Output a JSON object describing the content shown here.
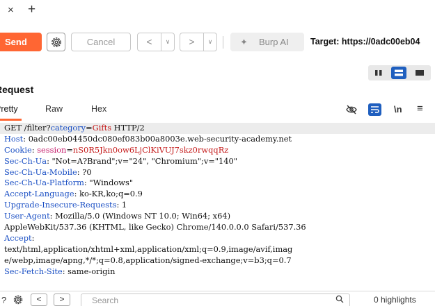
{
  "tabs": {
    "close_glyph": "×",
    "add_glyph": "+"
  },
  "toolbar": {
    "send_label": "Send",
    "cancel_label": "Cancel",
    "back_glyph": "<",
    "back_menu_glyph": "∨",
    "forward_glyph": ">",
    "forward_menu_glyph": "∨",
    "burp_ai_label": "Burp AI",
    "target_text": "Target: https://0adc00eb04",
    "accent": "#ff6633"
  },
  "request": {
    "section_title": "Request",
    "tabs": [
      "Pretty",
      "Raw",
      "Hex"
    ],
    "active_tab": "Pretty",
    "newline_toggle": "\\n",
    "menu_glyph": "≡"
  },
  "editor": {
    "request_line": "GET /filter?category=Gifts HTTP/2",
    "request_line_parts": {
      "method_path": "GET /filter?",
      "param_key": "category",
      "equals": "=",
      "param_value": "Gifts",
      "protocol": " HTTP/2"
    },
    "headers": [
      {
        "name": "Host",
        "value": "0adc00eb04450dc080ef083b00a8003e.web-security-academy.net"
      },
      {
        "name": "Cookie",
        "value": ""
      },
      {
        "name": "Sec-Ch-Ua",
        "value": "\"Not=A?Brand\";v=\"24\", \"Chromium\";v=\"140\""
      },
      {
        "name": "Sec-Ch-Ua-Mobile",
        "value": "?0"
      },
      {
        "name": "Sec-Ch-Ua-Platform",
        "value": "\"Windows\""
      },
      {
        "name": "Accept-Language",
        "value": "ko-KR,ko;q=0.9"
      },
      {
        "name": "Upgrade-Insecure-Requests",
        "value": "1"
      },
      {
        "name": "User-Agent",
        "value": "Mozilla/5.0 (Windows NT 10.0; Win64; x64)"
      }
    ],
    "cookie": {
      "key": "session",
      "value": "nS0R5Jkn0ow6LjClKiVUJ7skz0rwqqRz"
    },
    "user_agent_continued": "AppleWebKit/537.36 (KHTML, like Gecko) Chrome/140.0.0.0 Safari/537.36",
    "accept_name": "Accept",
    "accept_line1": "text/html,application/xhtml+xml,application/xml;q=0.9,image/avif,imag",
    "accept_line2": "e/webp,image/apng,*/*;q=0.8,application/signed-exchange;v=b3;q=0.7",
    "fetch_site": {
      "name": "Sec-Fetch-Site",
      "value": "same-origin"
    }
  },
  "bottom": {
    "help_glyph": "?",
    "back_glyph": "<",
    "forward_glyph": ">",
    "search_placeholder": "Search",
    "highlights_label": "0 highlights"
  }
}
